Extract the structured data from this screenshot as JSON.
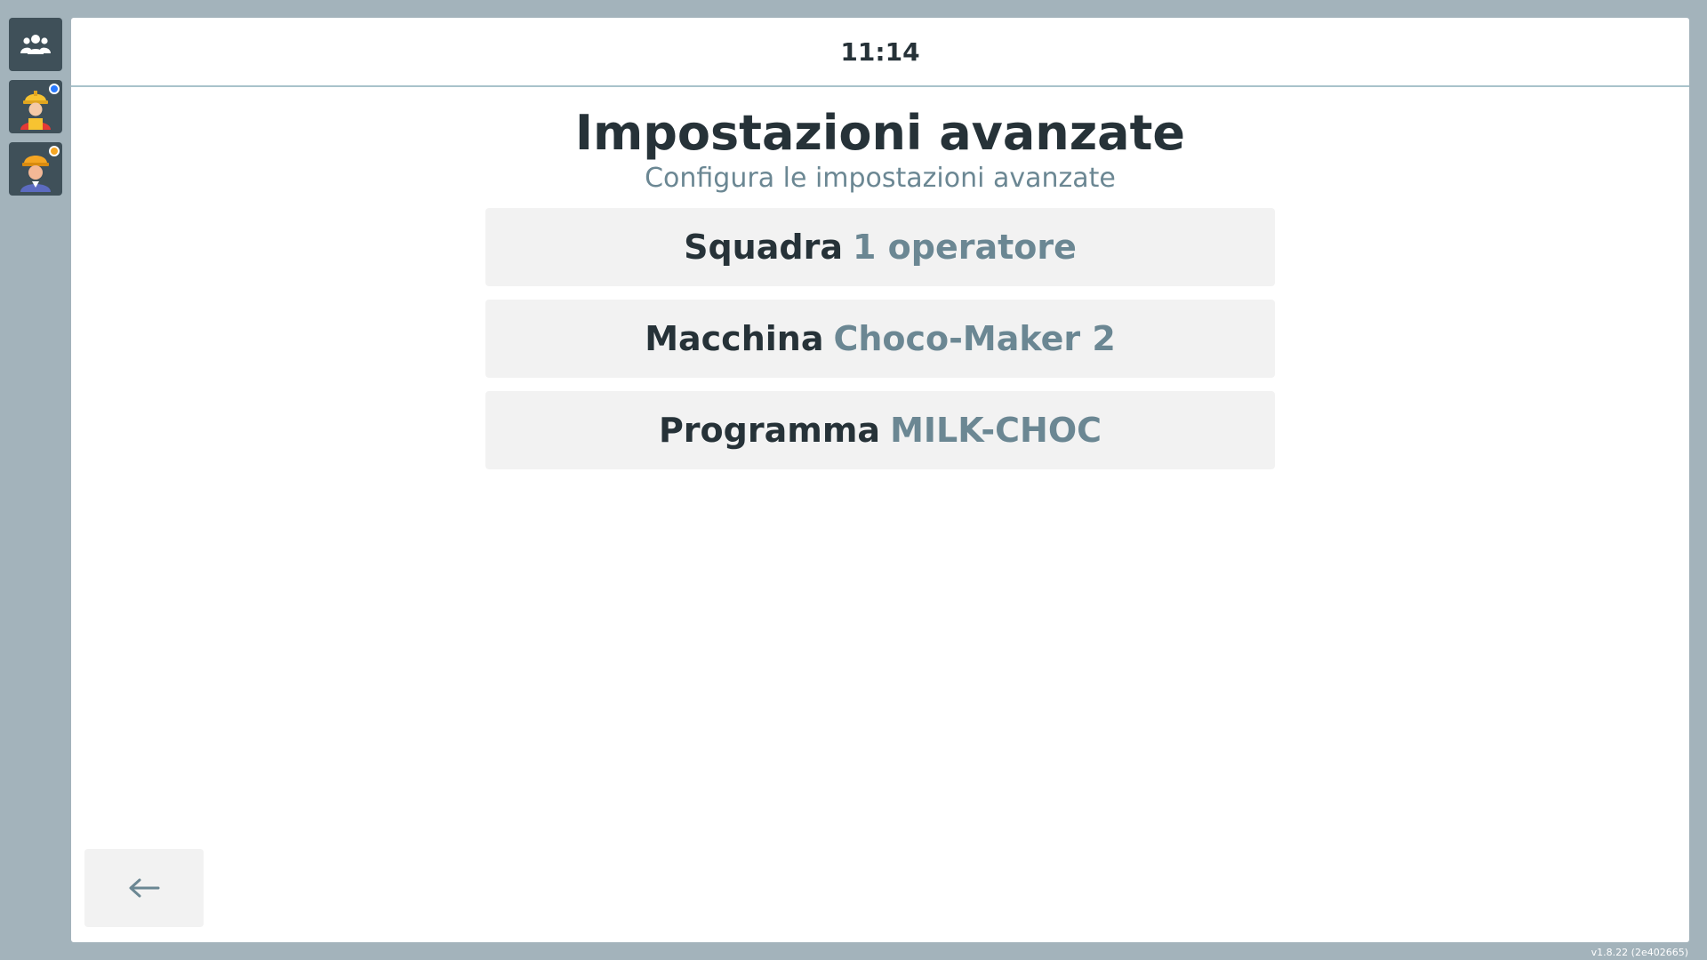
{
  "sidebar": {
    "items": [
      {
        "icon": "team-icon"
      },
      {
        "icon": "worker-icon",
        "status_color": "#2979ff"
      },
      {
        "icon": "engineer-icon",
        "status_color": "#f5a623"
      }
    ]
  },
  "header": {
    "time": "11:14"
  },
  "main": {
    "title": "Impostazioni avanzate",
    "subtitle": "Configura le impostazioni avanzate",
    "options": [
      {
        "label": "Squadra",
        "value": "1 operatore"
      },
      {
        "label": "Macchina",
        "value": "Choco-Maker 2"
      },
      {
        "label": "Programma",
        "value": "MILK-CHOC"
      }
    ]
  },
  "footer": {
    "back_icon": "arrow-left-icon",
    "version": "v1.8.22 (2e402665)"
  },
  "colors": {
    "sidebar_bg": "#3f5059",
    "app_bg": "#a3b3bb",
    "accent_value": "#6b8793",
    "text": "#263238"
  }
}
